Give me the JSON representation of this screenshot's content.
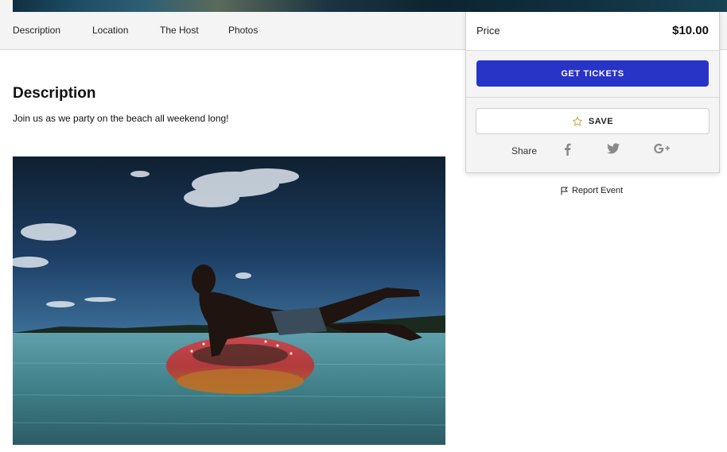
{
  "nav": {
    "items": [
      {
        "label": "Description"
      },
      {
        "label": "Location"
      },
      {
        "label": "The Host"
      },
      {
        "label": "Photos"
      }
    ]
  },
  "description": {
    "title": "Description",
    "text": "Join us as we party on the beach all weekend long!"
  },
  "ticket": {
    "price_label": "Price",
    "price_value": "$10.00",
    "get_tickets_label": "GET TICKETS",
    "save_label": "SAVE",
    "share_label": "Share",
    "social_icons": [
      "facebook-icon",
      "twitter-icon",
      "google-plus-icon"
    ],
    "accent_color": "#2833c8"
  },
  "report": {
    "label": "Report Event"
  }
}
